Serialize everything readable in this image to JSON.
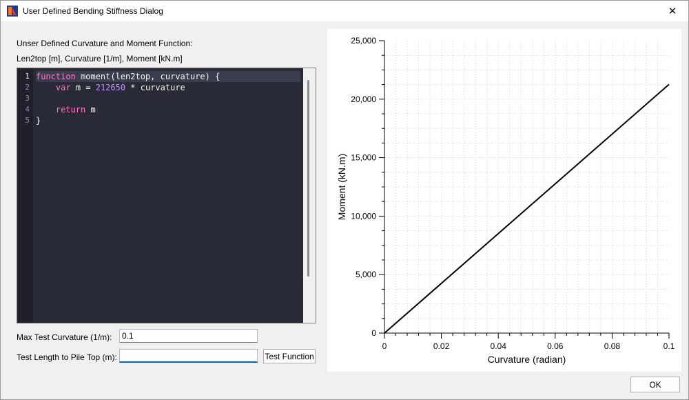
{
  "window": {
    "title": "User Defined Bending Stiffness Dialog"
  },
  "icons": {
    "app": "app-icon",
    "close": "close-icon"
  },
  "form": {
    "label_line1": "Unser Defined Curvature and Moment Function:",
    "label_line2": "Len2top [m], Curvature [1/m], Moment [kN.m]",
    "max_curv_label": "Max Test Curvature (1/m):",
    "max_curv_value": "0.1",
    "test_length_label": "Test Length to Pile Top (m):",
    "test_length_value": "",
    "test_button": "Test Function",
    "ok_button": "OK"
  },
  "editor": {
    "line_numbers": [
      "1",
      "2",
      "3",
      "4",
      "5"
    ],
    "lines": [
      [
        {
          "t": "function",
          "c": "kw"
        },
        {
          "t": " moment(len2top, curvature) {",
          "c": ""
        }
      ],
      [
        {
          "t": "    ",
          "c": ""
        },
        {
          "t": "var",
          "c": "kw"
        },
        {
          "t": " m = ",
          "c": ""
        },
        {
          "t": "212650",
          "c": "num"
        },
        {
          "t": " * curvature",
          "c": ""
        }
      ],
      [],
      [
        {
          "t": "    ",
          "c": ""
        },
        {
          "t": "return",
          "c": "kw"
        },
        {
          "t": " m",
          "c": ""
        }
      ],
      [
        {
          "t": "}",
          "c": ""
        }
      ]
    ],
    "colors": {
      "background": "#282a36",
      "keyword": "#ff79c6",
      "number": "#bd93f9",
      "text": "#f8f8f2"
    }
  },
  "chart_data": {
    "type": "line",
    "xlabel": "Curvature (radian)",
    "ylabel": "Moment (kN.m)",
    "xlim": [
      0,
      0.1
    ],
    "ylim": [
      0,
      25000
    ],
    "x_ticks": [
      "0",
      "0.02",
      "0.04",
      "0.06",
      "0.08",
      "0.1"
    ],
    "y_ticks": [
      "0",
      "5,000",
      "10,000",
      "15,000",
      "20,000",
      "25,000"
    ],
    "grid": true,
    "series": [
      {
        "x": [
          0,
          0.1
        ],
        "y": [
          0,
          21265
        ],
        "color": "#000000"
      }
    ]
  }
}
